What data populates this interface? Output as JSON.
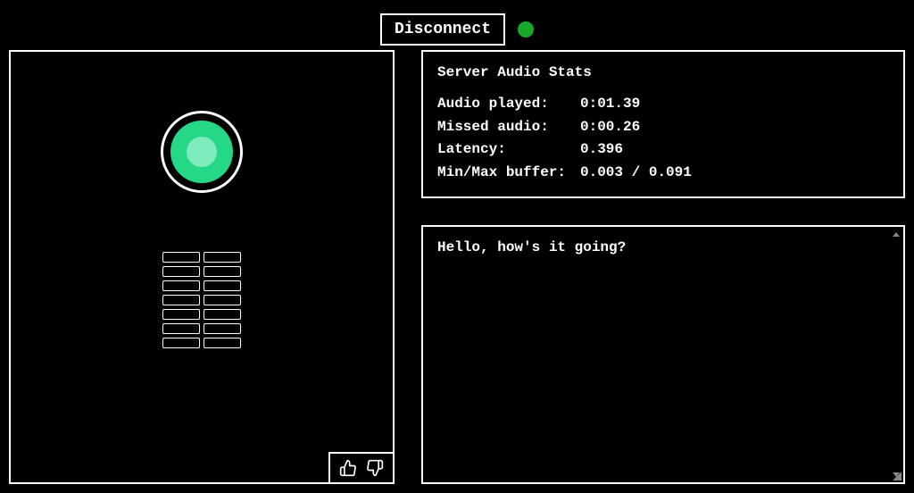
{
  "topbar": {
    "disconnect_label": "Disconnect",
    "status_color": "#1aa82a"
  },
  "orb": {
    "outer_color": "#24d886",
    "inner_color": "#7eebbc"
  },
  "bars": {
    "rows": 7,
    "cols": 2
  },
  "feedback": {
    "thumb_up": "thumb-up-icon",
    "thumb_down": "thumb-down-icon"
  },
  "stats": {
    "title": "Server Audio Stats",
    "rows": [
      {
        "label": "Audio played:",
        "value": "0:01.39"
      },
      {
        "label": "Missed audio:",
        "value": "0:00.26"
      },
      {
        "label": "Latency:",
        "value": "0.396"
      },
      {
        "label": "Min/Max buffer:",
        "value": "0.003 / 0.091"
      }
    ]
  },
  "transcript": {
    "text": "Hello, how's it going?"
  }
}
